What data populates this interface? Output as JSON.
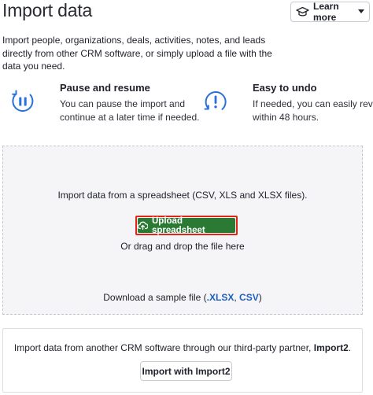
{
  "header": {
    "title": "Import data",
    "learn_more_label": "Learn more",
    "learn_more_icon": "graduation-cap-icon",
    "dropdown_icon": "caret-down-icon"
  },
  "intro_text": "Import people, organizations, deals, activities, notes, and leads directly from other CRM software, or simply upload a file with the data you need.",
  "features": [
    {
      "icon": "pause-circle-icon",
      "title": "Pause and resume",
      "description_line1": "You can pause the import and",
      "description_line2": "continue at a later time if needed."
    },
    {
      "icon": "undo-alert-icon",
      "title": "Easy to undo",
      "description_line1": "If needed, you can easily revert",
      "description_line2": "within 48 hours."
    }
  ],
  "dropzone": {
    "instruction": "Import data from a spreadsheet (CSV, XLS and XLSX files).",
    "upload_button_label": "Upload spreadsheet",
    "upload_icon": "cloud-upload-icon",
    "drag_text": "Or drag and drop the file here",
    "sample_prefix": "Download a sample file (",
    "sample_xlsx": ".XLSX",
    "sample_separator": ", ",
    "sample_csv": "CSV",
    "sample_suffix": ")"
  },
  "partner": {
    "text_prefix": "Import data from another CRM software through our third-party partner, ",
    "partner_name": "Import2",
    "text_suffix": ".",
    "button_label": "Import with Import2"
  },
  "colors": {
    "accent_green": "#2b7a33",
    "highlight_red": "#e2231a",
    "link_blue": "#1f5fbf",
    "icon_blue": "#2a6fdb"
  }
}
